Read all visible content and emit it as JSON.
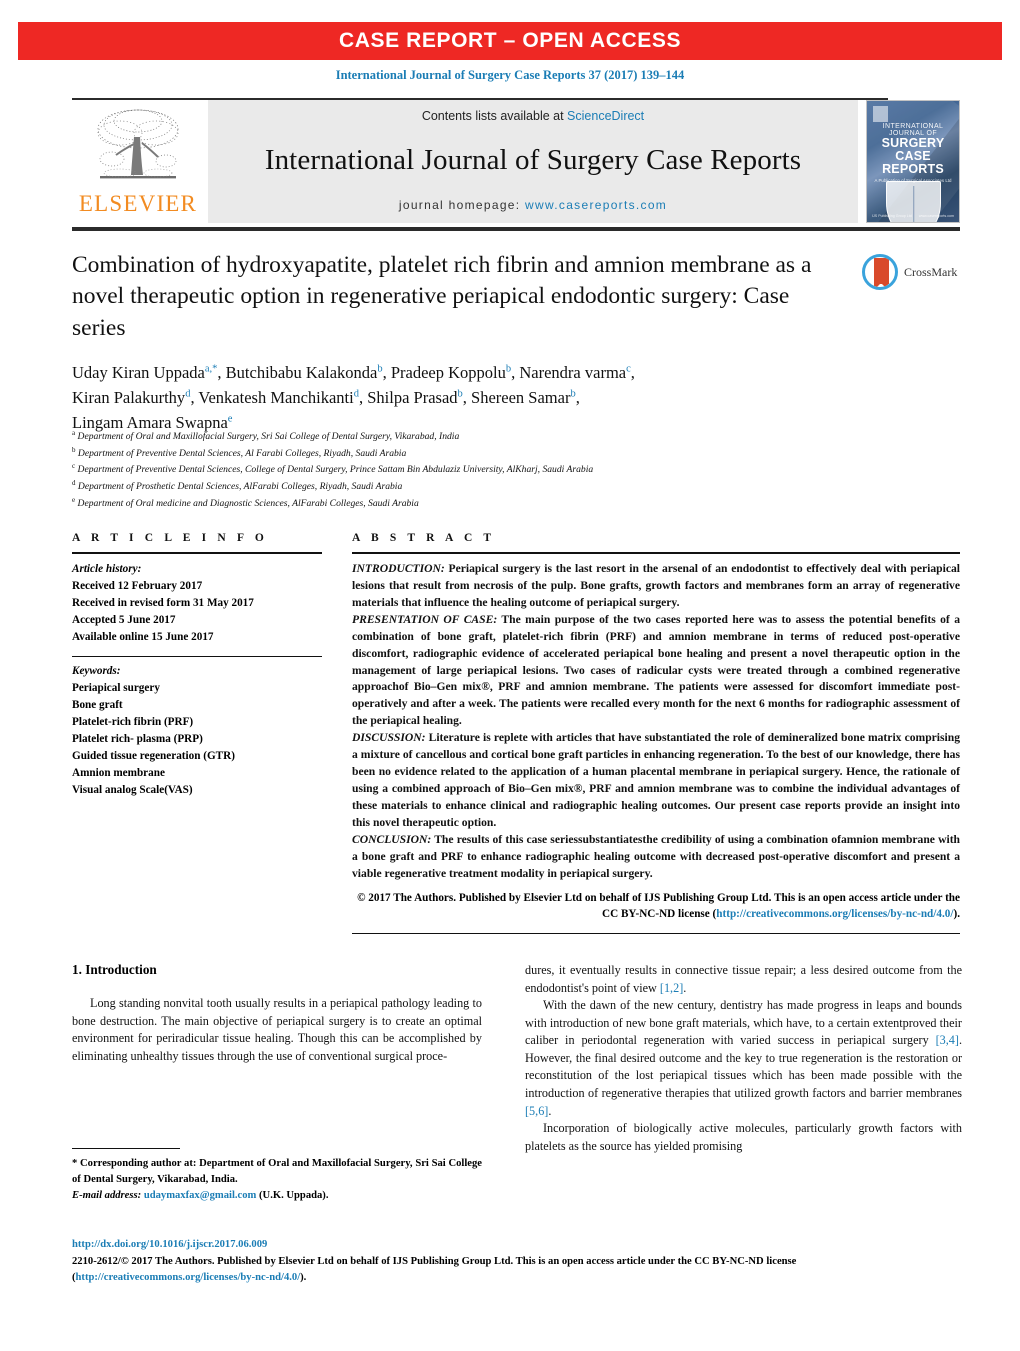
{
  "banner": {
    "text": "CASE REPORT – OPEN ACCESS"
  },
  "journal_ref": "International Journal of Surgery Case Reports 37 (2017) 139–144",
  "masthead": {
    "contents_prefix": "Contents lists available at ",
    "sciencedirect": "ScienceDirect",
    "journal_title": "International Journal of Surgery Case Reports",
    "homepage_prefix": "journal homepage: ",
    "homepage_url": "www.casereports.com",
    "publisher": "ELSEVIER",
    "cover": {
      "line1": "INTERNATIONAL",
      "line2": "JOURNAL OF",
      "line3": "SURGERY",
      "line4": "CASE",
      "line5": "REPORTS",
      "subline": "A Publication of Surgical Associates Ltd",
      "foot_left": "IJS Publishing Group Ltd",
      "foot_right": "www.casereports.com"
    }
  },
  "crossmark": {
    "label": "CrossMark"
  },
  "article": {
    "title": "Combination of hydroxyapatite, platelet rich fibrin and amnion membrane as a novel therapeutic option in regenerative periapical endodontic surgery: Case series",
    "authors_line1": "Uday Kiran Uppada",
    "authors_line1_sup": "a,*",
    "authors": [
      {
        "name": "Uday Kiran Uppada",
        "sup": "a,*"
      },
      {
        "name": "Butchibabu Kalakonda",
        "sup": "b"
      },
      {
        "name": "Pradeep Koppolu",
        "sup": "b"
      },
      {
        "name": "Narendra varma",
        "sup": "c"
      },
      {
        "name": "Kiran Palakurthy",
        "sup": "d"
      },
      {
        "name": "Venkatesh Manchikanti",
        "sup": "d"
      },
      {
        "name": "Shilpa Prasad",
        "sup": "b"
      },
      {
        "name": "Shereen Samar",
        "sup": "b"
      },
      {
        "name": "Lingam Amara Swapna",
        "sup": "e"
      }
    ],
    "affiliations": [
      {
        "mark": "a",
        "text": "Department of Oral and Maxillofacial Surgery, Sri Sai College of Dental Surgery, Vikarabad, India"
      },
      {
        "mark": "b",
        "text": "Department of Preventive Dental Sciences, Al Farabi Colleges, Riyadh, Saudi Arabia"
      },
      {
        "mark": "c",
        "text": "Department of Preventive Dental Sciences, College of Dental Surgery, Prince Sattam Bin Abdulaziz University, AlKharj, Saudi Arabia"
      },
      {
        "mark": "d",
        "text": "Department of Prosthetic Dental Sciences, AlFarabi Colleges, Riyadh, Saudi Arabia"
      },
      {
        "mark": "e",
        "text": "Department of Oral medicine and Diagnostic Sciences, AlFarabi Colleges, Saudi Arabia"
      }
    ]
  },
  "article_info": {
    "heading": "A R T I C L E   I N F O",
    "history_label": "Article history:",
    "history": [
      "Received 12 February 2017",
      "Received in revised form 31 May 2017",
      "Accepted 5 June 2017",
      "Available online 15 June 2017"
    ],
    "keywords_label": "Keywords:",
    "keywords": [
      "Periapical surgery",
      "Bone graft",
      "Platelet-rich fibrin (PRF)",
      "Platelet rich- plasma (PRP)",
      "Guided tissue regeneration (GTR)",
      "Amnion membrane",
      "Visual analog Scale(VAS)"
    ]
  },
  "abstract": {
    "heading": "A B S T R A C T",
    "sections": [
      {
        "label": "INTRODUCTION:",
        "text": " Periapical surgery is the last resort in the arsenal of an endodontist to effectively deal with periapical lesions that result from necrosis of the pulp. Bone grafts, growth factors and membranes form an array of regenerative materials that influence the healing outcome of periapical surgery."
      },
      {
        "label": "PRESENTATION OF CASE:",
        "text": " The main purpose of the two cases reported here was to assess the potential benefits of a combination of bone graft, platelet-rich fibrin (PRF) and amnion membrane in terms of reduced post-operative discomfort, radiographic evidence of accelerated periapical bone healing and present a novel therapeutic option in the management of large periapical lesions. Two cases of radicular cysts were treated through a combined regenerative approachof Bio–Gen mix®, PRF and amnion membrane. The patients were assessed for discomfort immediate post-operatively and after a week. The patients were recalled every month for the next 6 months for radiographic assessment of the periapical healing."
      },
      {
        "label": "DISCUSSION:",
        "text": " Literature is replete with articles that have substantiated the role of demineralized bone matrix comprising a mixture of cancellous and cortical bone graft particles in enhancing regeneration. To the best of our knowledge, there has been no evidence related to the application of a human placental membrane in periapical surgery. Hence, the rationale of using a combined approach of Bio–Gen mix®, PRF and amnion membrane was to combine the individual advantages of these materials to enhance clinical and radiographic healing outcomes. Our present case reports provide an insight into this novel therapeutic option."
      },
      {
        "label": "CONCLUSION:",
        "text": " The results of this case seriessubstantiatesthe credibility of using a combination ofamnion membrane with a bone graft and PRF to enhance radiographic healing outcome with decreased post-operative discomfort and present a viable regenerative treatment modality in periapical surgery."
      }
    ],
    "copyright_pre": "© 2017 The Authors. Published by Elsevier Ltd on behalf of IJS Publishing Group Ltd. This is an open access article under the CC BY-NC-ND license (",
    "copyright_link": "http://creativecommons.org/licenses/by-nc-nd/4.0/",
    "copyright_post": ")."
  },
  "intro": {
    "heading": "1.  Introduction",
    "left_p1": "Long standing nonvital tooth usually results in a periapical pathology leading to bone destruction. The main objective of periapical surgery is to create an optimal environment for periradicular tissue healing. Though this can be accomplished by eliminating unhealthy tissues through the use of conventional surgical proce-",
    "right_p1_pre": "dures, it eventually results in connective tissue repair; a less desired outcome from the endodontist's point of view ",
    "right_p1_ref": "[1,2]",
    "right_p1_post": ".",
    "right_p2_a": "With the dawn of the new century, dentistry has made progress in leaps and bounds with introduction of new bone graft materials, which have, to a certain extentproved their caliber in periodontal regeneration with varied success in periapical surgery ",
    "right_p2_ref1": "[3,4]",
    "right_p2_b": ". However, the final desired outcome and the key to true regeneration is the restoration or reconstitution of the lost periapical tissues which has been made possible with the introduction of regenerative therapies that utilized growth factors and barrier membranes ",
    "right_p2_ref2": "[5,6]",
    "right_p2_c": ".",
    "right_p3": "Incorporation of biologically active molecules, particularly growth factors with platelets as the source has yielded promising"
  },
  "footnote": {
    "star": "*",
    "corresponding_text": " Corresponding author at: Department of Oral and Maxillofacial Surgery, Sri Sai College of Dental Surgery, Vikarabad, India.",
    "email_label": "E-mail address:",
    "email": "udaymaxfax@gmail.com",
    "email_owner": " (U.K. Uppada)."
  },
  "bottom": {
    "doi": "http://dx.doi.org/10.1016/j.ijscr.2017.06.009",
    "issn_line_pre": "2210-2612/© 2017 The Authors. Published by Elsevier Ltd on behalf of IJS Publishing Group Ltd. This is an open access article under the CC BY-NC-ND license (",
    "issn_link": "http://creativecommons.org/licenses/by-nc-nd/4.0/",
    "issn_line_post": ")."
  },
  "colors": {
    "banner_red": "#ee2824",
    "link_blue": "#1b7db5",
    "elsevier_orange": "#f28b21",
    "masthead_grey": "#eaeaea"
  }
}
